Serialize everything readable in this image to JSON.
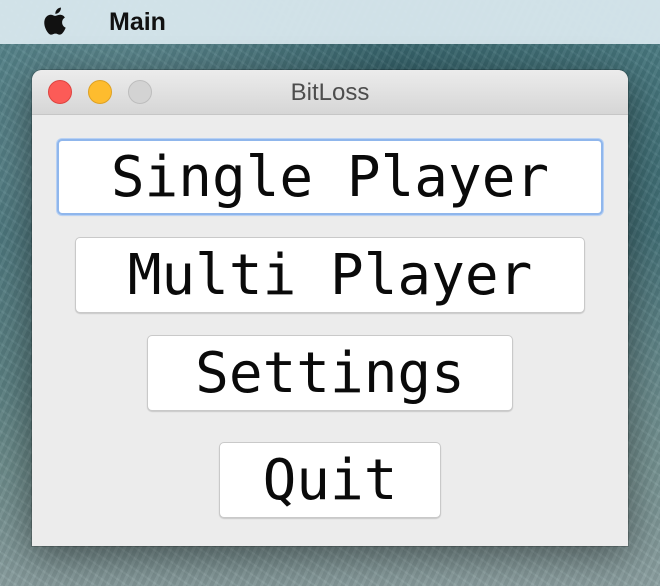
{
  "menubar": {
    "apple_icon": "apple-logo-icon",
    "app_name": "Main"
  },
  "window": {
    "title": "BitLoss",
    "controls": {
      "close": "close-icon",
      "minimize": "minimize-icon",
      "zoom": "zoom-icon"
    },
    "colors": {
      "close": "#fc5b57",
      "minimize": "#febc2e",
      "zoom": "#d3d3d3",
      "focus_ring": "#8fb6ec"
    }
  },
  "main_menu": {
    "buttons": [
      {
        "label": "Single Player",
        "focused": true
      },
      {
        "label": "Multi Player",
        "focused": false
      },
      {
        "label": "Settings",
        "focused": false
      },
      {
        "label": "Quit",
        "focused": false
      }
    ]
  }
}
